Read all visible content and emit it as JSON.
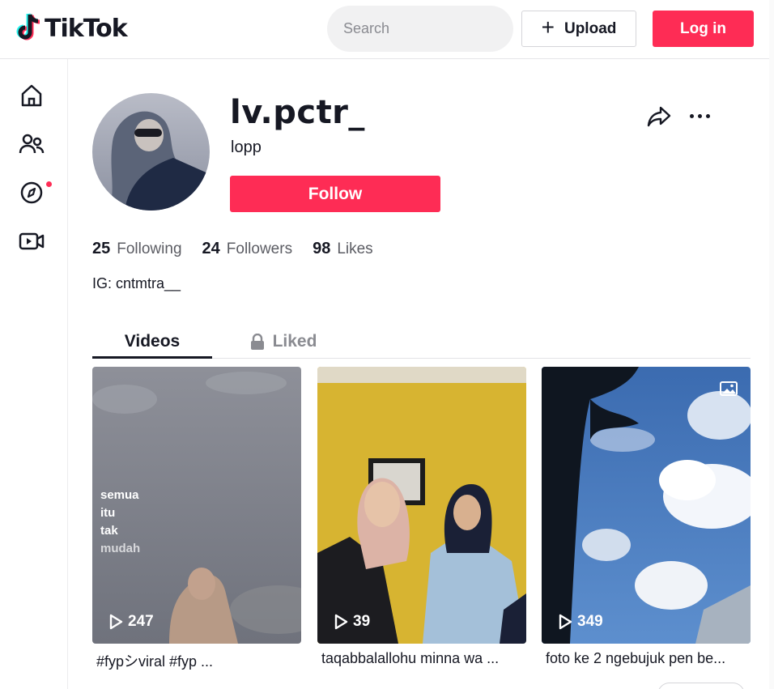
{
  "header": {
    "logo_text": "TikTok",
    "search_placeholder": "Search",
    "upload_label": "Upload",
    "login_label": "Log in"
  },
  "sidebar": {
    "items": [
      {
        "icon": "home-icon"
      },
      {
        "icon": "following-icon"
      },
      {
        "icon": "explore-icon",
        "has_dot": true
      },
      {
        "icon": "live-icon"
      }
    ]
  },
  "profile": {
    "username": "lv.pctr_",
    "nickname": "lopp",
    "follow_label": "Follow",
    "following_count": "25",
    "following_label": "Following",
    "followers_count": "24",
    "followers_label": "Followers",
    "likes_count": "98",
    "likes_label": "Likes",
    "bio": "IG: cntmtra__"
  },
  "tabs": {
    "videos": "Videos",
    "liked": "Liked"
  },
  "videos": [
    {
      "views": "247",
      "caption": "#fypシviral #fyp ...",
      "overlay_lines": [
        "semua",
        "itu",
        "tak",
        "mudah"
      ]
    },
    {
      "views": "39",
      "caption": "taqabbalallohu minna wa ..."
    },
    {
      "views": "349",
      "caption": "foto ke 2 ngebujuk pen be...",
      "photo_badge": true
    }
  ],
  "colors": {
    "brand": "#fe2c55",
    "text": "#161823",
    "muted": "#8a8b91"
  }
}
